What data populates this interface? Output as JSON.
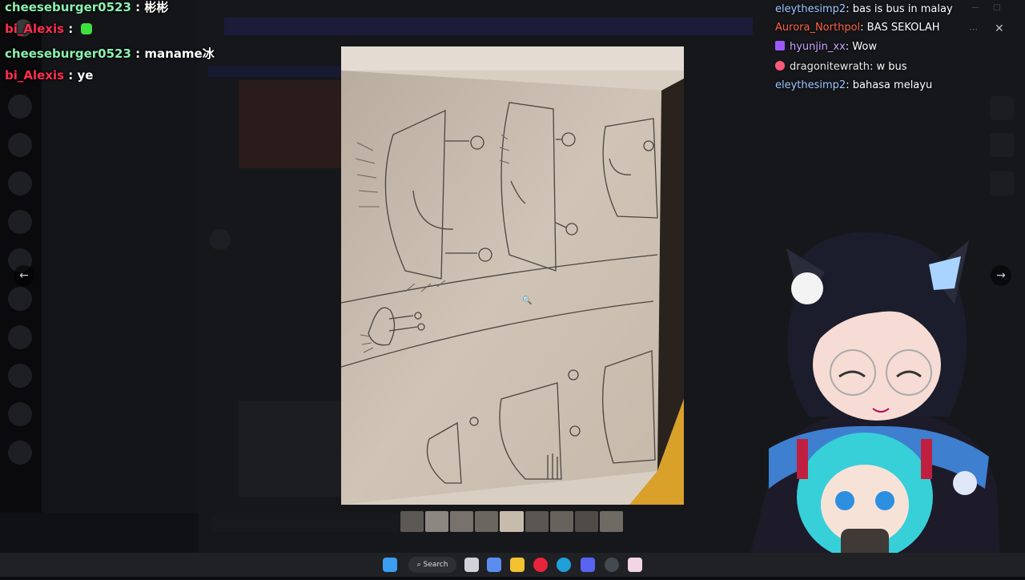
{
  "colors": {
    "username_green": "#8df0b0",
    "username_red": "#ff2e4e",
    "paper": "#c7bbac",
    "background": "#111216",
    "taskbar": "#202124"
  },
  "left_chat": [
    {
      "user": "cheeseburger0523",
      "separator": " : ",
      "text": "彬彬"
    },
    {
      "user": "bi_Alexis",
      "separator": " : ",
      "text": ""
    },
    {
      "user": "cheeseburger0523",
      "separator": " : ",
      "text": "maname冰"
    },
    {
      "user": "bi_Alexis",
      "separator": " : ",
      "text": "ye"
    }
  ],
  "right_chat": [
    {
      "user": "eleythesimp2",
      "separator": ": ",
      "text": "bas is bus in malay"
    },
    {
      "user": "Aurora_Northpol",
      "separator": ": ",
      "text": "BAS SEKOLAH"
    },
    {
      "user": "hyunjin_xx",
      "separator": ": ",
      "text": "Wow"
    },
    {
      "user": "dragonitewrath",
      "separator": ": ",
      "text": "w bus"
    },
    {
      "user": "eleythesimp2",
      "separator": ": ",
      "text": "bahasa melayu"
    }
  ],
  "icons": {
    "prev": "←",
    "next": "→",
    "close": "✕",
    "more": "⋯",
    "zoom": "🔍",
    "minimize": "—",
    "maximize": "□"
  },
  "taskbar": {
    "search_label": "Search"
  }
}
